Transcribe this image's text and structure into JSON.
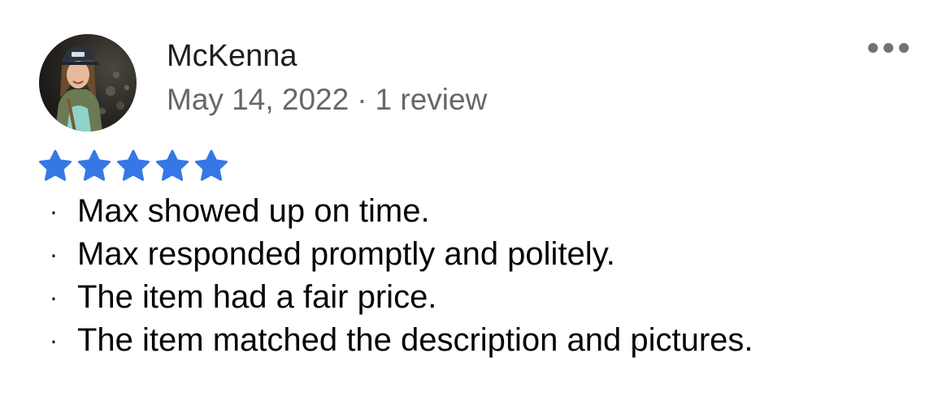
{
  "review": {
    "reviewer_name": "McKenna",
    "date": "May 14, 2022",
    "separator": "·",
    "review_count": "1 review",
    "rating": 5,
    "rating_max": 5,
    "star_color": "#3578e5",
    "more_icon": "more-horizontal-icon",
    "bullet_glyph": "·",
    "comments": [
      "Max showed up on time.",
      "Max responded promptly and politely.",
      "The item had a fair price.",
      "The item matched the description and pictures."
    ]
  }
}
